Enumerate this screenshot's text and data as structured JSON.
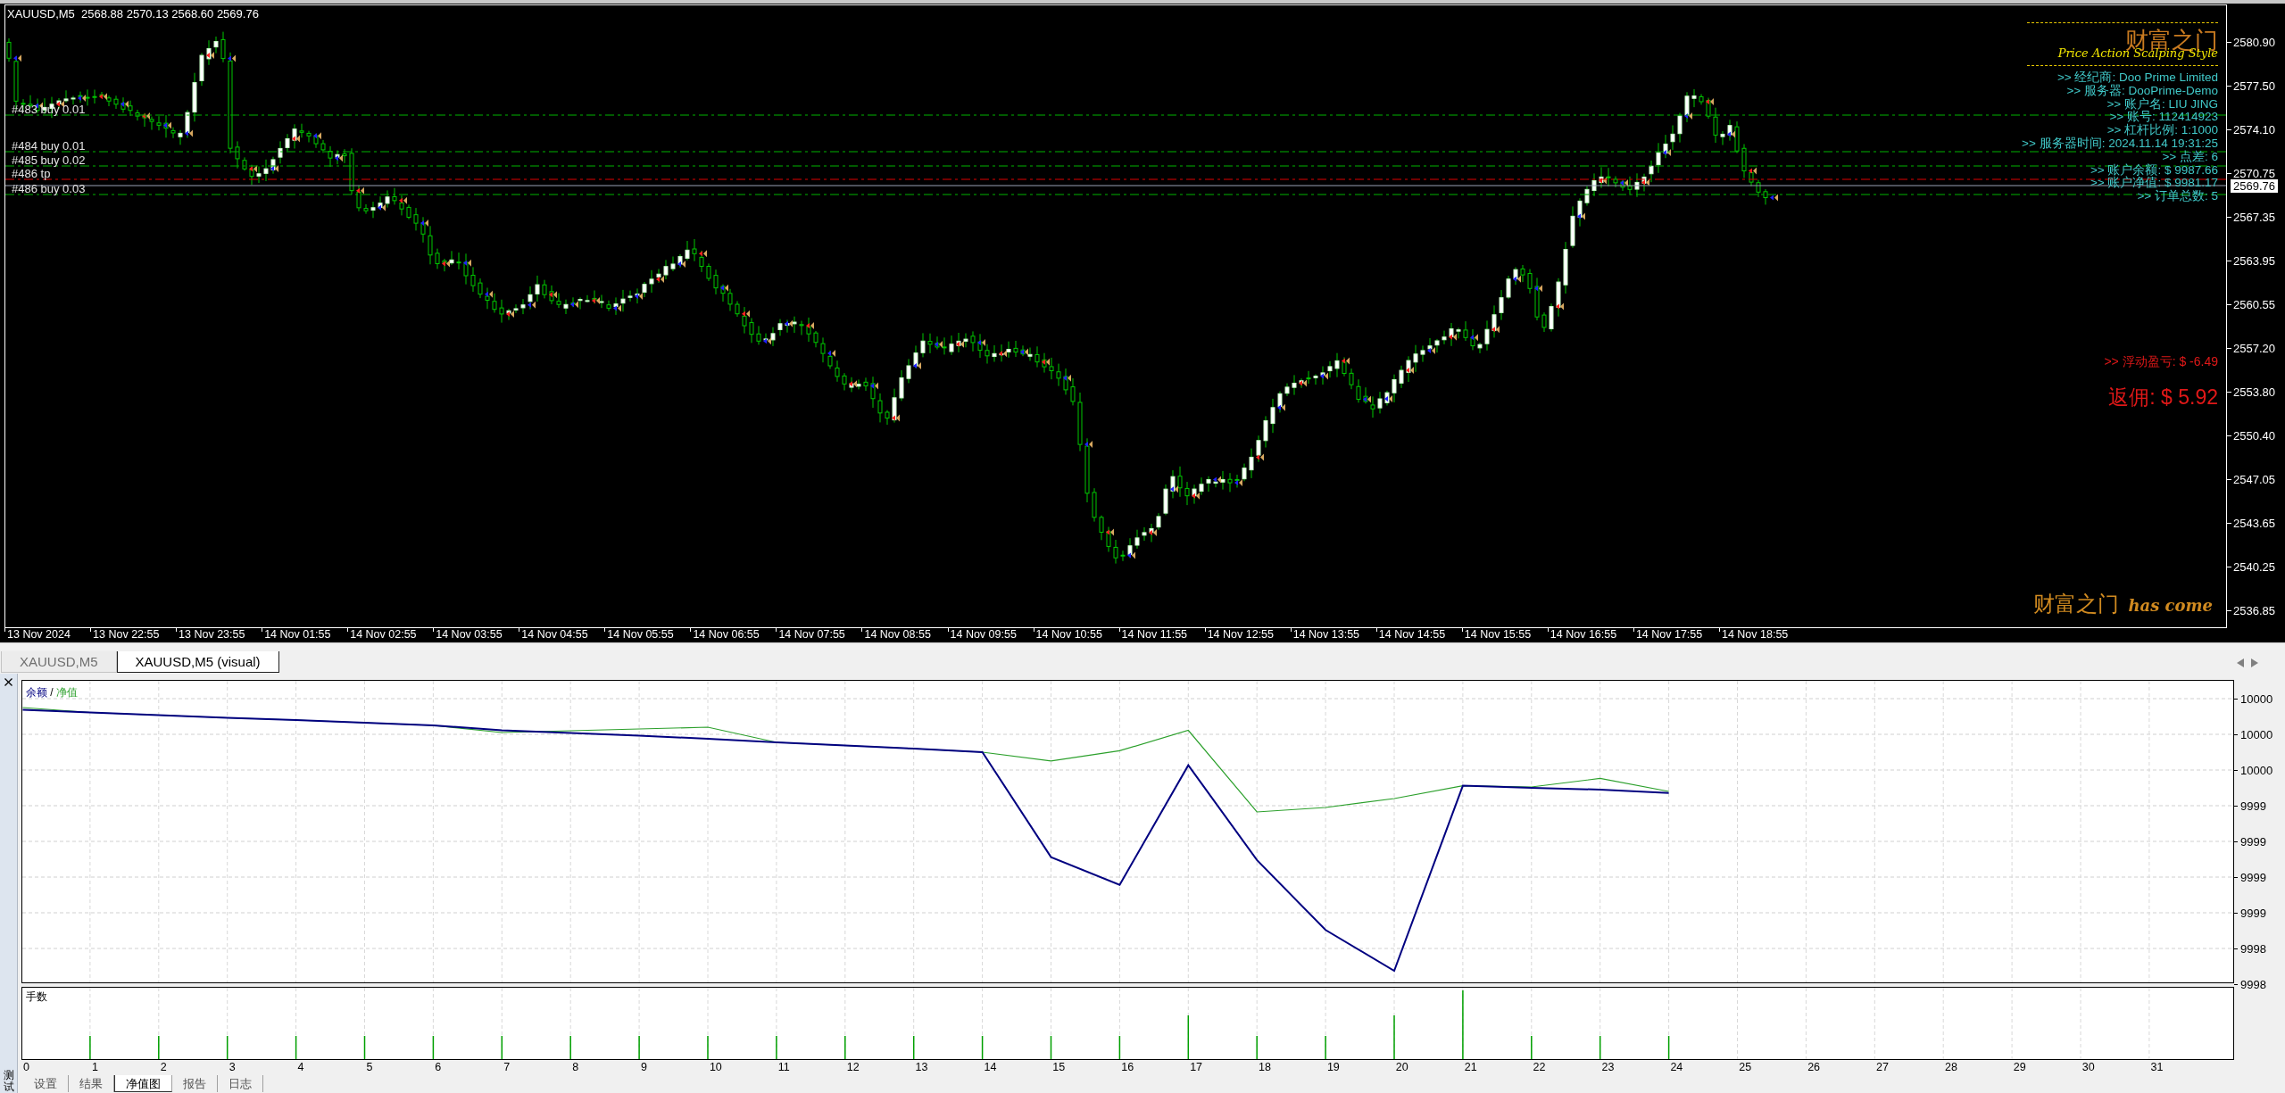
{
  "chart": {
    "header": "XAUUSD,M5  2568.88 2570.13 2568.60 2569.76",
    "order_lines": [
      {
        "label": "#483 buy 0.01",
        "kind": "entry"
      },
      {
        "label": "#484 buy 0.01",
        "kind": "entry"
      },
      {
        "label": "#485 buy 0.02",
        "kind": "entry"
      },
      {
        "label": "#486 tp",
        "kind": "tp"
      },
      {
        "label": "#486 buy 0.03",
        "kind": "entry"
      }
    ],
    "current_price": "2569.76",
    "price_axis": [
      "2580.90",
      "2577.50",
      "2574.10",
      "2570.75",
      "2567.35",
      "2563.95",
      "2560.55",
      "2557.20",
      "2553.80",
      "2550.40",
      "2547.05",
      "2543.65",
      "2540.25",
      "2536.85"
    ],
    "time_axis": [
      "13 Nov 2024",
      "13 Nov 22:55",
      "13 Nov 23:55",
      "14 Nov 01:55",
      "14 Nov 02:55",
      "14 Nov 03:55",
      "14 Nov 04:55",
      "14 Nov 05:55",
      "14 Nov 06:55",
      "14 Nov 07:55",
      "14 Nov 08:55",
      "14 Nov 09:55",
      "14 Nov 10:55",
      "14 Nov 11:55",
      "14 Nov 12:55",
      "14 Nov 13:55",
      "14 Nov 14:55",
      "14 Nov 15:55",
      "14 Nov 16:55",
      "14 Nov 17:55",
      "14 Nov 18:55"
    ],
    "info_panel": {
      "title": "财富之门",
      "subtitle": "Price Action Scalping Style",
      "lines": [
        ">> 经纪商: Doo Prime Limited",
        ">> 服务器: DooPrime-Demo",
        ">> 账户名: LIU JING",
        ">> 账号: 112414923",
        ">> 杠杆比例: 1:1000",
        ">> 服务器时间: 2024.11.14 19:31:25",
        ">> 点差: 6",
        ">> 账户余额: $ 9987.66",
        ">> 账户净值: $ 9981.17",
        ">> 订单总数: 5"
      ],
      "floating_pl": ">> 浮动盈亏: $ -6.49",
      "rebate": "返佣: $ 5.92"
    },
    "footer_brand": {
      "title": "财富之门",
      "tagline": "has come"
    }
  },
  "chart_tabs": [
    {
      "label": "XAUUSD,M5",
      "selected": false
    },
    {
      "label": "XAUUSD,M5 (visual)",
      "selected": true
    }
  ],
  "tester": {
    "side_label": "测试",
    "equity_graph": {
      "series": [
        {
          "name": "余额",
          "color": "#000080"
        },
        {
          "name": "净值",
          "color": "#2ca02c"
        }
      ],
      "separator": "/",
      "y_axis": [
        "10000",
        "10000",
        "10000",
        "9999",
        "9999",
        "9999",
        "9999",
        "9998",
        "9998"
      ],
      "x_axis": [
        "0",
        "1",
        "2",
        "3",
        "4",
        "5",
        "6",
        "7",
        "8",
        "9",
        "10",
        "11",
        "12",
        "13",
        "14",
        "15",
        "16",
        "17",
        "18",
        "19",
        "20",
        "21",
        "22",
        "23",
        "24",
        "25",
        "26",
        "27",
        "28",
        "29",
        "30",
        "31"
      ]
    },
    "lots_graph": {
      "title": "手数"
    },
    "tabs": [
      {
        "label": "设置",
        "selected": false
      },
      {
        "label": "结果",
        "selected": false
      },
      {
        "label": "净值图",
        "selected": true
      },
      {
        "label": "报告",
        "selected": false
      },
      {
        "label": "日志",
        "selected": false
      }
    ]
  }
}
